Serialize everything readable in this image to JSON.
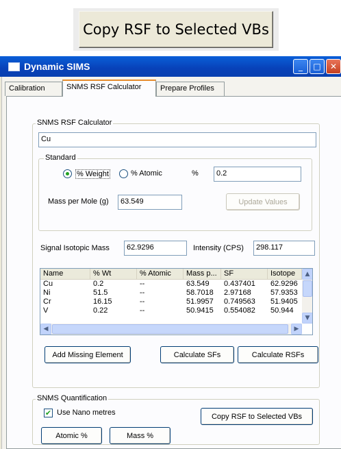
{
  "top_button": {
    "label": "Copy RSF to Selected VBs"
  },
  "window": {
    "title": "Dynamic SIMS",
    "controls": {
      "minimize": "_",
      "maximize": "□",
      "close": "✕"
    }
  },
  "tabs": [
    {
      "label": "Calibration",
      "active": false
    },
    {
      "label": "SNMS RSF Calculator",
      "active": true
    },
    {
      "label": "Prepare Profiles",
      "active": false
    }
  ],
  "calculator": {
    "group_label": "SNMS RSF Calculator",
    "element_input": "Cu",
    "standard": {
      "group_label": "Standard",
      "radio_weight": "% Weight",
      "radio_atomic": "% Atomic",
      "percent_label": "%",
      "percent_value": "0.2",
      "mass_label": "Mass per Mole (g)",
      "mass_value": "63.549",
      "update_button": "Update Values"
    },
    "signal_label": "Signal Isotopic Mass",
    "signal_value": "62.9296",
    "intensity_label": "Intensity (CPS)",
    "intensity_value": "298.117",
    "table": {
      "columns": [
        "Name",
        "% Wt",
        "% Atomic",
        "Mass p...",
        "SF",
        "Isotope"
      ],
      "rows": [
        [
          "Cu",
          "0.2",
          "--",
          "63.549",
          "0.437401",
          "62.9296"
        ],
        [
          "Ni",
          "51.5",
          "--",
          "58.7018",
          "2.97168",
          "57.9353"
        ],
        [
          "Cr",
          "16.15",
          "--",
          "51.9957",
          "0.749563",
          "51.9405"
        ],
        [
          "V",
          "0.22",
          "--",
          "50.9415",
          "0.554082",
          "50.944"
        ]
      ]
    },
    "buttons": {
      "add_missing": "Add Missing Element",
      "calc_sfs": "Calculate SFs",
      "calc_rsfs": "Calculate RSFs"
    }
  },
  "quantification": {
    "group_label": "SNMS Quantification",
    "checkbox_label": "Use Nano metres",
    "checkbox_checked": true,
    "copy_button": "Copy RSF to Selected VBs",
    "atomic_button": "Atomic %",
    "mass_button": "Mass %"
  }
}
